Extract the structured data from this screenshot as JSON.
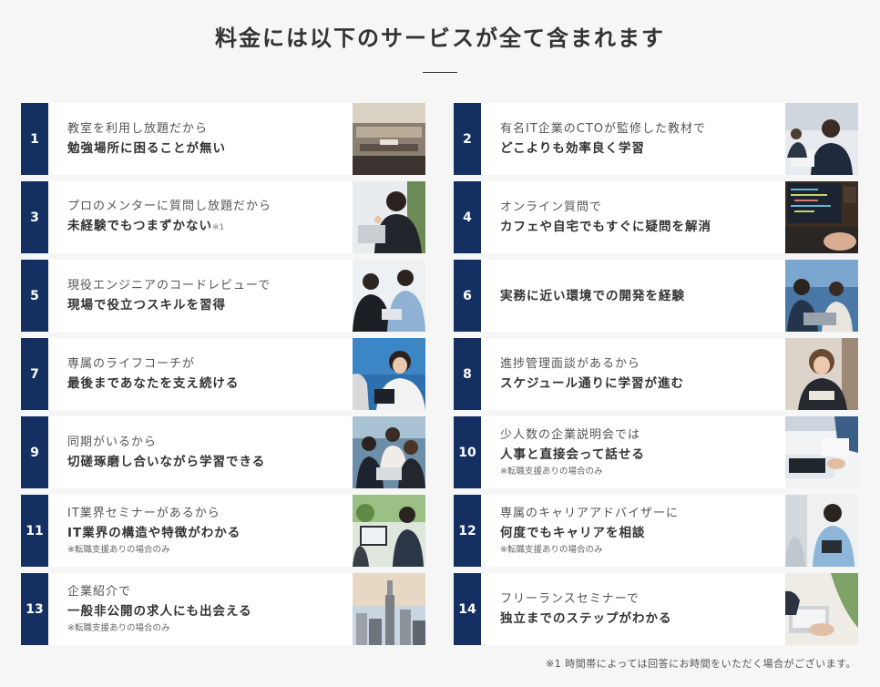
{
  "heading": "料金には以下のサービスが全て含まれます",
  "footnote": "※1 時間帯によっては回答にお時間をいただく場合がございます。",
  "colors": {
    "number_badge": "#143062",
    "background": "#f6f6f6"
  },
  "cards": [
    {
      "num": "1",
      "sub": "教室を利用し放題だから",
      "main": "勉強場所に困ることが無い",
      "mark": "",
      "note": "",
      "photo": "office-photo"
    },
    {
      "num": "2",
      "sub": "有名IT企業のCTOが監修した教材で",
      "main": "どこよりも効率良く学習",
      "mark": "",
      "note": "",
      "photo": "businessman-photo"
    },
    {
      "num": "3",
      "sub": "プロのメンターに質問し放題だから",
      "main": "未経験でもつまずかない",
      "mark": "※1",
      "note": "",
      "photo": "mentor-photo"
    },
    {
      "num": "4",
      "sub": "オンライン質問で",
      "main": "カフェや自宅でもすぐに疑問を解消",
      "mark": "",
      "note": "",
      "photo": "laptop-code-photo"
    },
    {
      "num": "5",
      "sub": "現役エンジニアのコードレビューで",
      "main": "現場で役立つスキルを習得",
      "mark": "",
      "note": "",
      "photo": "code-review-photo"
    },
    {
      "num": "6",
      "sub": "",
      "main": "実務に近い環境での開発を経験",
      "mark": "",
      "note": "",
      "photo": "team-dev-photo"
    },
    {
      "num": "7",
      "sub": "専属のライフコーチが",
      "main": "最後まであなたを支え続ける",
      "mark": "",
      "note": "",
      "photo": "coach-photo"
    },
    {
      "num": "8",
      "sub": "進捗管理面談があるから",
      "main": "スケジュール通りに学習が進む",
      "mark": "",
      "note": "",
      "photo": "interview-photo"
    },
    {
      "num": "9",
      "sub": "同期がいるから",
      "main": "切磋琢磨し合いながら学習できる",
      "mark": "",
      "note": "",
      "photo": "peers-photo"
    },
    {
      "num": "10",
      "sub": "少人数の企業説明会では",
      "main": "人事と直接会って話せる",
      "mark": "",
      "note": "※転職支援ありの場合のみ",
      "photo": "meeting-photo"
    },
    {
      "num": "11",
      "sub": "IT業界セミナーがあるから",
      "main": "IT業界の構造や特徴がわかる",
      "mark": "",
      "note": "※転職支援ありの場合のみ",
      "photo": "seminar-photo"
    },
    {
      "num": "12",
      "sub": "専属のキャリアアドバイザーに",
      "main": "何度でもキャリアを相談",
      "mark": "",
      "note": "※転職支援ありの場合のみ",
      "photo": "advisor-photo"
    },
    {
      "num": "13",
      "sub": "企業紹介で",
      "main": "一般非公開の求人にも出会える",
      "mark": "",
      "note": "※転職支援ありの場合のみ",
      "photo": "city-photo"
    },
    {
      "num": "14",
      "sub": "フリーランスセミナーで",
      "main": "独立までのステップがわかる",
      "mark": "",
      "note": "",
      "photo": "freelance-photo"
    }
  ]
}
